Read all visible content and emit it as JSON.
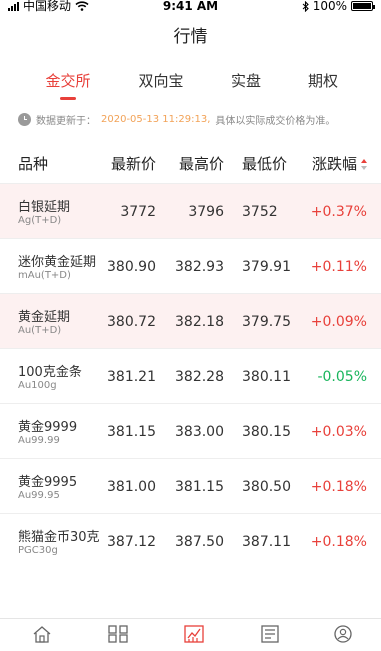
{
  "status_bar": {
    "carrier": "中国移动",
    "time": "9:41 AM",
    "battery": "100%"
  },
  "nav": {
    "title": "行情"
  },
  "tabs": [
    {
      "label": "金交所",
      "active": true
    },
    {
      "label": "双向宝",
      "active": false
    },
    {
      "label": "实盘",
      "active": false
    },
    {
      "label": "期权",
      "active": false
    }
  ],
  "update_notice": {
    "prefix": "数据更新于：",
    "time": "2020-05-13 11:29:13,",
    "suffix": "具体以实际成交价格为准。"
  },
  "table": {
    "headers": [
      "品种",
      "最新价",
      "最高价",
      "最低价",
      "涨跌幅"
    ],
    "rows": [
      {
        "name": "白银延期",
        "code": "Ag(T+D)",
        "latest": "3772",
        "high": "3796",
        "low": "3752",
        "change": "+0.37%",
        "dir": "up",
        "highlight": true
      },
      {
        "name": "迷你黄金延期",
        "code": "mAu(T+D)",
        "latest": "380.90",
        "high": "382.93",
        "low": "379.91",
        "change": "+0.11%",
        "dir": "up",
        "highlight": false
      },
      {
        "name": "黄金延期",
        "code": "Au(T+D)",
        "latest": "380.72",
        "high": "382.18",
        "low": "379.75",
        "change": "+0.09%",
        "dir": "up",
        "highlight": true
      },
      {
        "name": "100克金条",
        "code": "Au100g",
        "latest": "381.21",
        "high": "382.28",
        "low": "380.11",
        "change": "-0.05%",
        "dir": "down",
        "highlight": false
      },
      {
        "name": "黄金9999",
        "code": "Au99.99",
        "latest": "381.15",
        "high": "383.00",
        "low": "380.15",
        "change": "+0.03%",
        "dir": "up",
        "highlight": false
      },
      {
        "name": "黄金9995",
        "code": "Au99.95",
        "latest": "381.00",
        "high": "381.15",
        "low": "380.50",
        "change": "+0.18%",
        "dir": "up",
        "highlight": false
      },
      {
        "name": "熊猫金币30克",
        "code": "PGC30g",
        "latest": "387.12",
        "high": "387.50",
        "low": "387.11",
        "change": "+0.18%",
        "dir": "up",
        "highlight": false
      }
    ]
  },
  "tabbar": {
    "items": [
      {
        "label": "首页",
        "icon": "home-icon",
        "active": false
      },
      {
        "label": "交易",
        "icon": "grid-icon",
        "active": false
      },
      {
        "label": "行情",
        "icon": "chart-icon",
        "active": true
      },
      {
        "label": "资讯",
        "icon": "news-icon",
        "active": false
      },
      {
        "label": "我的",
        "icon": "user-icon",
        "active": false
      }
    ]
  },
  "colors": {
    "accent": "#e8403a",
    "up": "#e8403a",
    "down": "#19b55c",
    "highlight_row": "#fdf1f1",
    "update_time": "#f2a257"
  }
}
